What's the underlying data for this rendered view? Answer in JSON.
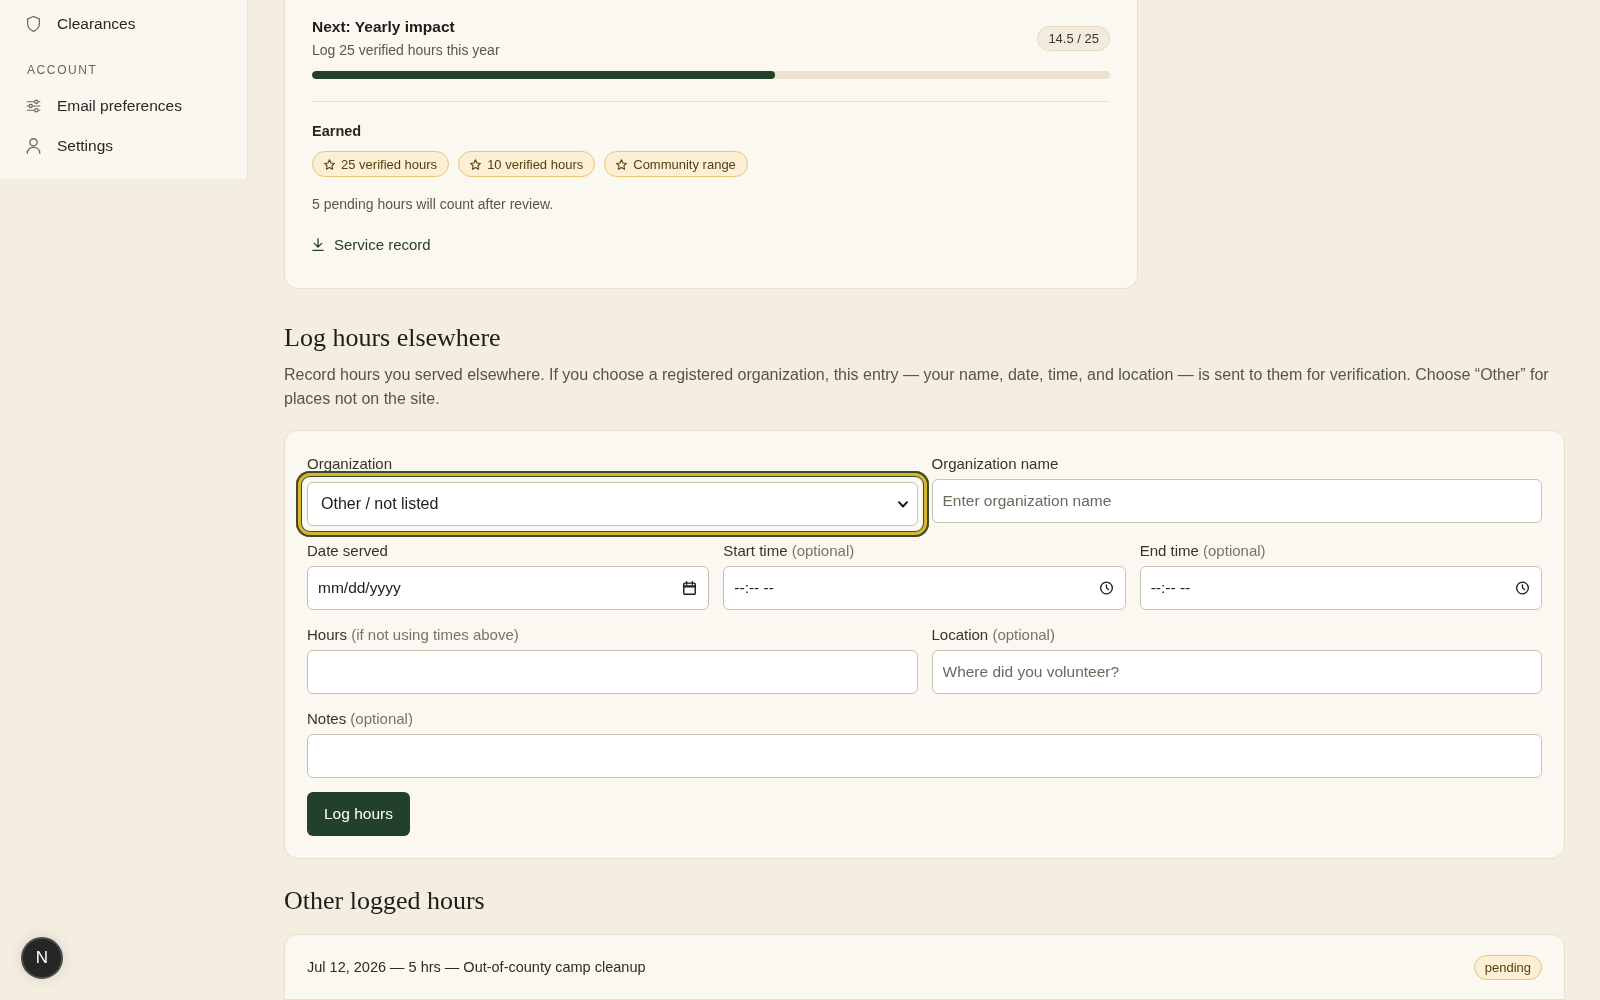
{
  "sidebar": {
    "groups": [
      {
        "items": [
          {
            "label": "Clearances",
            "selected": false
          }
        ]
      },
      {
        "heading": "ACCOUNT",
        "items": [
          {
            "label": "Email preferences",
            "selected": false
          },
          {
            "label": "Settings",
            "selected": false
          }
        ]
      }
    ]
  },
  "milestone": {
    "title": "Next: Yearly impact",
    "subtitle": "Log 25 verified hours this year",
    "count": "14.5 / 25",
    "progress": {
      "level": 0.58
    },
    "earned_heading": "Earned",
    "badges": [
      "25 verified hours",
      "10 verified hours",
      "Community range"
    ],
    "note": "5 pending hours will count after review.",
    "link": "Service record"
  },
  "log_hours": {
    "heading": "Log hours elsewhere",
    "description": "Record hours you served elsewhere. If you choose a registered organization, this entry — your name, date, time, and location — is sent to them for verification. Choose “Other” for places not on the site.",
    "rows": [
      {
        "fields": [
          {
            "kind": "select",
            "label": "Organization",
            "value": "Other / not listed",
            "focused": true
          },
          {
            "kind": "text",
            "label": "Organization name",
            "placeholder": "Enter organization name"
          }
        ]
      },
      {
        "fields": [
          {
            "kind": "date",
            "label": "Date served",
            "placeholder": "mm/dd/yyyy"
          },
          {
            "kind": "time",
            "label": "Start time",
            "hint": "(optional)",
            "placeholder": "--:-- --"
          },
          {
            "kind": "time",
            "label": "End time",
            "hint": "(optional)",
            "placeholder": "--:-- --"
          }
        ]
      },
      {
        "fields": [
          {
            "kind": "text",
            "label": "Hours",
            "hint": "(if not using times above)"
          },
          {
            "kind": "text",
            "label": "Location",
            "hint": "(optional)",
            "placeholder": "Where did you volunteer?"
          }
        ]
      },
      {
        "fields": [
          {
            "kind": "text",
            "label": "Notes",
            "hint": "(optional)"
          }
        ]
      }
    ],
    "submit": "Log hours"
  },
  "other_logged": {
    "heading": "Other logged hours",
    "entries": [
      {
        "text": "Jul 12, 2026 — 5 hrs — Out-of-county camp cleanup",
        "status": "pending"
      }
    ]
  },
  "dev_indicator": {
    "label": "N"
  }
}
